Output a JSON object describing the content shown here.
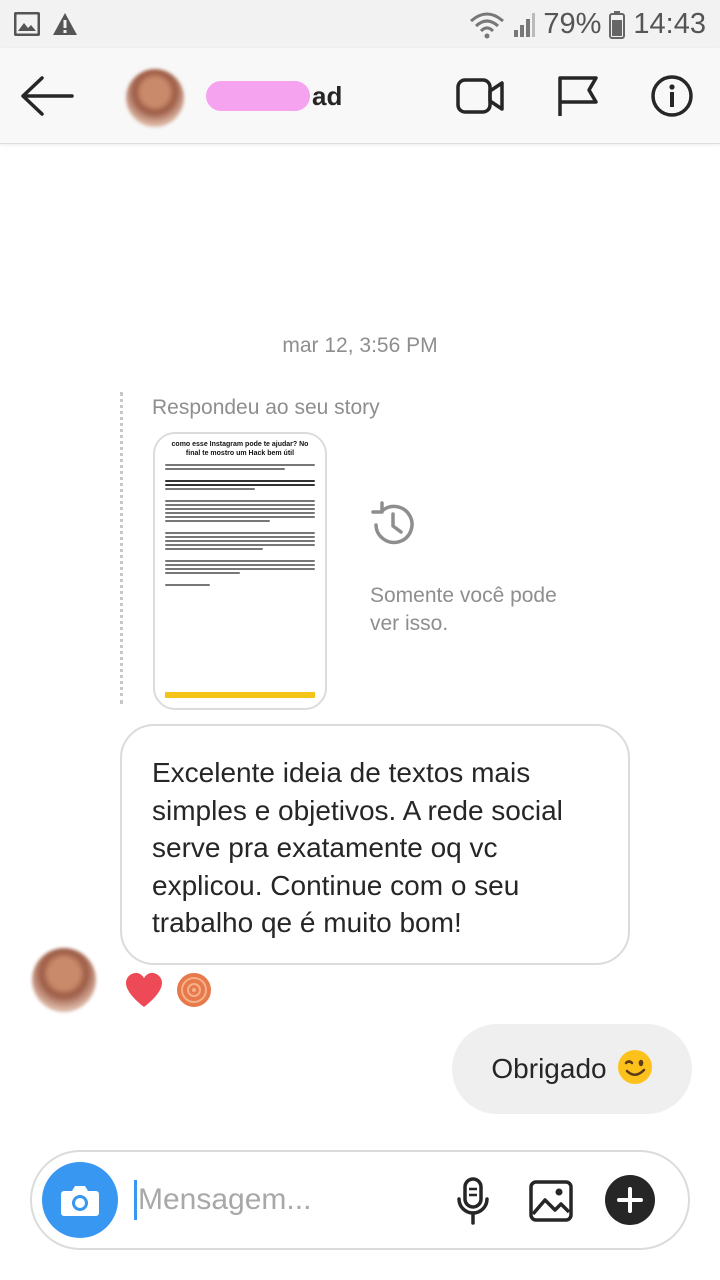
{
  "status_bar": {
    "battery": "79%",
    "time": "14:43",
    "icons": [
      "gallery-icon",
      "warning-icon",
      "wifi-icon",
      "signal-icon",
      "battery-icon"
    ]
  },
  "header": {
    "name_suffix": "ad",
    "icons": [
      "back-arrow-icon",
      "video-call-icon",
      "flag-icon",
      "info-icon"
    ]
  },
  "thread": {
    "timestamp": "mar 12, 3:56 PM",
    "story_reply": {
      "caption": "Respondeu ao seu story",
      "thumbnail_title": "como esse Instagram pode te ajudar? No final te mostro um Hack bem útil",
      "notice": "Somente você pode ver isso."
    },
    "incoming_message": "Excelente ideia de textos mais simples e objetivos. A rede social serve pra exatamente oq vc explicou. Continue com o seu trabalho qe é muito bom!",
    "reactions": [
      "heart-icon",
      "reactor-avatar"
    ],
    "outgoing_message": "Obrigado"
  },
  "composer": {
    "placeholder": "Mensagem...",
    "value": ""
  },
  "colors": {
    "accent": "#3897f0",
    "heart": "#ed4956",
    "text": "#262626",
    "muted": "#8e8e8e",
    "bubble_out": "#efefef"
  }
}
